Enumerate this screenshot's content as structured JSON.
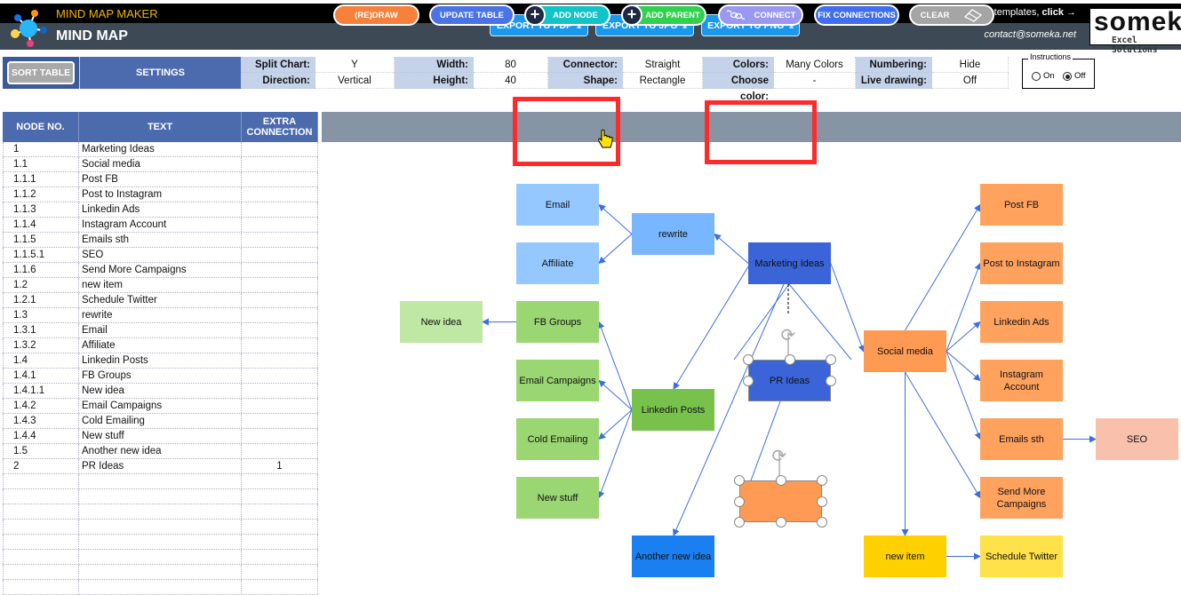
{
  "header": {
    "subtitle": "MIND MAP MAKER",
    "title": "MIND MAP",
    "export_buttons": [
      {
        "label": "EXPORT TO PDF",
        "icon": "download-icon"
      },
      {
        "label": "EXPORT TO JPG",
        "icon": "download-icon"
      },
      {
        "label": "EXPORT TO PNG",
        "icon": "download-icon"
      }
    ],
    "promo_text": "For more templates, ",
    "promo_link": "click →",
    "contact": "contact@someka.net",
    "brand_name": "someka",
    "brand_tagline": "Excel Solutions"
  },
  "settings": {
    "sort_button": "SORT TABLE",
    "heading": "SETTINGS",
    "fields": [
      {
        "label": "Split Chart:",
        "value": "Y"
      },
      {
        "label": "Direction:",
        "value": "Vertical"
      },
      {
        "label": "Width:",
        "value": "80"
      },
      {
        "label": "Height:",
        "value": "40"
      },
      {
        "label": "Connector:",
        "value": "Straight"
      },
      {
        "label": "Shape:",
        "value": "Rectangle"
      },
      {
        "label": "Colors:",
        "value": "Many Colors"
      },
      {
        "label": "Choose color:",
        "value": "-"
      },
      {
        "label": "Numbering:",
        "value": "Hide"
      },
      {
        "label": "Live drawing:",
        "value": "Off"
      }
    ],
    "instructions": {
      "title": "Instructions",
      "on_label": "On",
      "off_label": "Off",
      "selected": "Off"
    }
  },
  "table": {
    "headers": [
      "NODE NO.",
      "TEXT",
      "EXTRA CONNECTION"
    ],
    "rows": [
      [
        "1",
        "Marketing Ideas",
        ""
      ],
      [
        "1.1",
        "Social media",
        ""
      ],
      [
        "1.1.1",
        "Post FB",
        ""
      ],
      [
        "1.1.2",
        "Post to Instagram",
        ""
      ],
      [
        "1.1.3",
        "Linkedin Ads",
        ""
      ],
      [
        "1.1.4",
        "Instagram Account",
        ""
      ],
      [
        "1.1.5",
        "Emails sth",
        ""
      ],
      [
        "1.1.5.1",
        "SEO",
        ""
      ],
      [
        "1.1.6",
        "Send More Campaigns",
        ""
      ],
      [
        "1.2",
        "new item",
        ""
      ],
      [
        "1.2.1",
        "Schedule Twitter",
        ""
      ],
      [
        "1.3",
        "rewrite",
        ""
      ],
      [
        "1.3.1",
        "Email",
        ""
      ],
      [
        "1.3.2",
        "Affiliate",
        ""
      ],
      [
        "1.4",
        "Linkedin Posts",
        ""
      ],
      [
        "1.4.1",
        "FB Groups",
        ""
      ],
      [
        "1.4.1.1",
        "New idea",
        ""
      ],
      [
        "1.4.2",
        "Email Campaigns",
        ""
      ],
      [
        "1.4.3",
        "Cold Emailing",
        ""
      ],
      [
        "1.4.4",
        "New stuff",
        ""
      ],
      [
        "1.5",
        "Another new idea",
        ""
      ],
      [
        "2",
        "PR Ideas",
        "1"
      ],
      [
        "",
        "",
        ""
      ],
      [
        "",
        "",
        ""
      ],
      [
        "",
        "",
        ""
      ],
      [
        "",
        "",
        ""
      ],
      [
        "",
        "",
        ""
      ],
      [
        "",
        "",
        ""
      ],
      [
        "",
        "",
        ""
      ],
      [
        "",
        "",
        ""
      ]
    ]
  },
  "toolbar": {
    "redraw": "(RE)DRAW",
    "update_table": "UPDATE TABLE",
    "add_node": "ADD NODE",
    "add_parent": "ADD PARENT",
    "connect": "CONNECT",
    "fix_connections": "FIX CONNECTIONS",
    "clear": "CLEAR"
  },
  "colors": {
    "root": "#3a64d8",
    "orange": "#ff9e57",
    "light_orange": "#f9c0a8",
    "yellow": "#ffd000",
    "light_yellow": "#ffe14a",
    "blue_light": "#86c0ff",
    "blue_mid": "#6aaeff",
    "green": "#7cc94e",
    "green_light": "#a6dc80",
    "green_pale": "#c3ecaa",
    "bright_blue": "#1a7ff0",
    "selected_empty": "#ff9a55",
    "connector": "#3b6fe0"
  },
  "mindmap": {
    "nodes": [
      {
        "id": "marketing",
        "text": "Marketing Ideas",
        "color": "#3a64d8"
      },
      {
        "id": "social",
        "text": "Social media",
        "color": "#ff9a52"
      },
      {
        "id": "postfb",
        "text": "Post FB",
        "color": "#ffa25e"
      },
      {
        "id": "postig",
        "text": "Post to Instagram",
        "color": "#ffa25e"
      },
      {
        "id": "liads",
        "text": "Linkedin Ads",
        "color": "#ffa25e"
      },
      {
        "id": "igacc",
        "text": "Instagram Account",
        "color": "#ffa25e"
      },
      {
        "id": "emails",
        "text": "Emails sth",
        "color": "#ffa25e"
      },
      {
        "id": "seo",
        "text": "SEO",
        "color": "#f9c1ac"
      },
      {
        "id": "sendmore",
        "text": "Send More Campaigns",
        "color": "#ffa25e"
      },
      {
        "id": "newitem",
        "text": "new item",
        "color": "#ffd000"
      },
      {
        "id": "twitter",
        "text": "Schedule Twitter",
        "color": "#ffe14a"
      },
      {
        "id": "rewrite",
        "text": "rewrite",
        "color": "#78b6ff"
      },
      {
        "id": "email",
        "text": "Email",
        "color": "#94c8ff"
      },
      {
        "id": "affiliate",
        "text": "Affiliate",
        "color": "#94c8ff"
      },
      {
        "id": "liposts",
        "text": "Linkedin Posts",
        "color": "#78c24c"
      },
      {
        "id": "fbgroups",
        "text": "FB Groups",
        "color": "#9ad672"
      },
      {
        "id": "newidea",
        "text": "New idea",
        "color": "#bfe8a4"
      },
      {
        "id": "emailcamp",
        "text": "Email Campaigns",
        "color": "#9ad672"
      },
      {
        "id": "coldemail",
        "text": "Cold Emailing",
        "color": "#9ad672"
      },
      {
        "id": "newstuff",
        "text": "New stuff",
        "color": "#9ad672"
      },
      {
        "id": "another",
        "text": "Another new idea",
        "color": "#1a7ff0"
      },
      {
        "id": "pr",
        "text": "PR Ideas",
        "color": "#3a64d8"
      },
      {
        "id": "newshape",
        "text": "",
        "color": "#ff9a55"
      }
    ]
  }
}
